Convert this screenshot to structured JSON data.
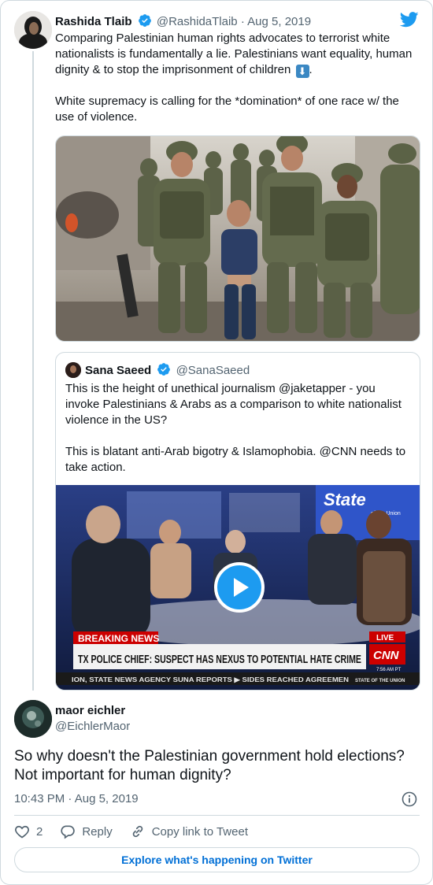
{
  "tweet": {
    "author_name": "Rashida Tlaib",
    "author_handle": "@RashidaTlaib",
    "separator": "·",
    "date": "Aug 5, 2019",
    "paragraph1": "Comparing Palestinian human rights advocates to terrorist white nationalists is fundamentally a lie. Palestinians want equality, human dignity & to stop the imprisonment of children",
    "emoji": "⬇",
    "paragraph1_end": ".",
    "paragraph2": "White supremacy is calling for the *domination* of one race w/ the use of violence."
  },
  "quote": {
    "author_name": "Sana Saeed",
    "author_handle": "@SanaSaeed",
    "paragraph1": "This is the height of unethical journalism @jaketapper - you invoke Palestinians & Arabs as a comparison to white nationalist violence in the US?",
    "paragraph2": "This is blatant anti-Arab bigotry & Islamophobia. @CNN needs to take action.",
    "video": {
      "show_logo": "State",
      "show_logo_small": "of the Union",
      "breaking": "BREAKING NEWS",
      "headline": "TX POLICE CHIEF: SUSPECT HAS NEXUS TO POTENTIAL HATE CRIME",
      "ticker": "ION, STATE NEWS AGENCY SUNA REPORTS   ▶   SIDES REACHED AGREEMEN",
      "ticker_right": "STATE OF THE UNION",
      "live": "LIVE",
      "network": "CNN",
      "time": "7:56 AM PT"
    }
  },
  "reply": {
    "author_name": "maor eichler",
    "author_handle": "@EichlerMaor",
    "text": "So why doesn't the Palestinian government hold elections? Not important for human dignity?",
    "time": "10:43 PM",
    "separator": "·",
    "date": "Aug 5, 2019",
    "likes": "2",
    "reply_label": "Reply",
    "copy_link_label": "Copy link to Tweet"
  },
  "explore_label": "Explore what's happening on Twitter",
  "colors": {
    "twitter_blue": "#1d9bf0",
    "link_blue": "#006fd6",
    "border": "#cfd9de",
    "secondary_text": "#536471",
    "cnn_red": "#cc0000"
  }
}
